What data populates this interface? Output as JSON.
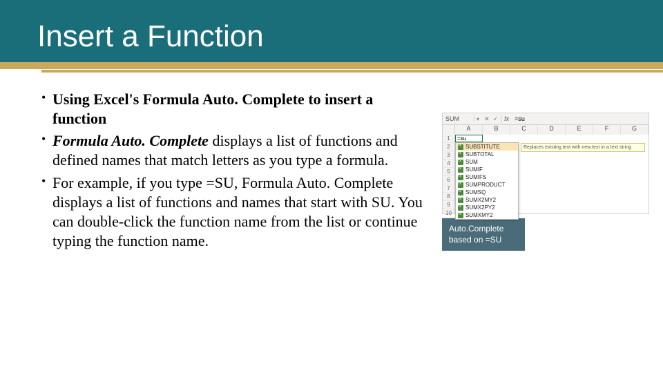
{
  "title": "Insert a Function",
  "bullets": {
    "b1_bold": "Using Excel's Formula Auto. Complete to insert a function",
    "b2_emph": "Formula Auto. Complete",
    "b2_rest": " displays a list of functions and defined names that match letters as you type a formula.",
    "b3": "For example, if you type =SU, Formula Auto. Complete displays a list of functions and names that start with SU. You can double-click the function name from the list or continue typing the function name."
  },
  "excel": {
    "namebox": "SUM",
    "formula": "=su",
    "cell_value": "=su",
    "columns": [
      "A",
      "B",
      "C",
      "D",
      "E",
      "F",
      "G"
    ],
    "rows": [
      "1",
      "2",
      "3",
      "4",
      "5",
      "6",
      "7",
      "8",
      "9",
      "10"
    ],
    "dropdown": [
      "SUBSTITUTE",
      "SUBTOTAL",
      "SUM",
      "SUMIF",
      "SUMIFS",
      "SUMPRODUCT",
      "SUMSQ",
      "SUMX2MY2",
      "SUMX2PY2",
      "SUMXMY2"
    ],
    "tooltip": "Replaces existing text with new text in a text string",
    "caption": "Auto.Complete based on =SU"
  }
}
